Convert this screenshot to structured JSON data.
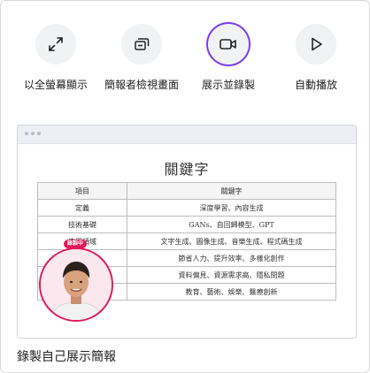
{
  "actions": [
    {
      "label": "以全螢幕顯示",
      "icon": "expand-icon"
    },
    {
      "label": "簡報者檢視畫面",
      "icon": "presenter-view-icon"
    },
    {
      "label": "展示並錄製",
      "icon": "video-camera-icon",
      "selected": true
    },
    {
      "label": "自動播放",
      "icon": "play-icon"
    }
  ],
  "preview": {
    "slide_title": "關鍵字",
    "table": {
      "header": [
        "項目",
        "關鍵字"
      ],
      "rows": [
        [
          "定義",
          "深度學習、內容生成"
        ],
        [
          "技術基礎",
          "GANs、自回歸模型、GPT"
        ],
        [
          "應用領域",
          "文字生成、圖像生成、音樂生成、程式碼生成"
        ],
        [
          "",
          "節省人力、提升效率、多樣化創作"
        ],
        [
          "",
          "資料偏見、資源需求高、隱私問題"
        ],
        [
          "",
          "教育、藝術、娛樂、醫療創新"
        ]
      ]
    },
    "recording_badge": "錄製中"
  },
  "caption": "錄製自己展示簡報",
  "colors": {
    "accent": "#7c3aed",
    "recording": "#e0185a",
    "icon_bg": "#f1f2f4"
  }
}
